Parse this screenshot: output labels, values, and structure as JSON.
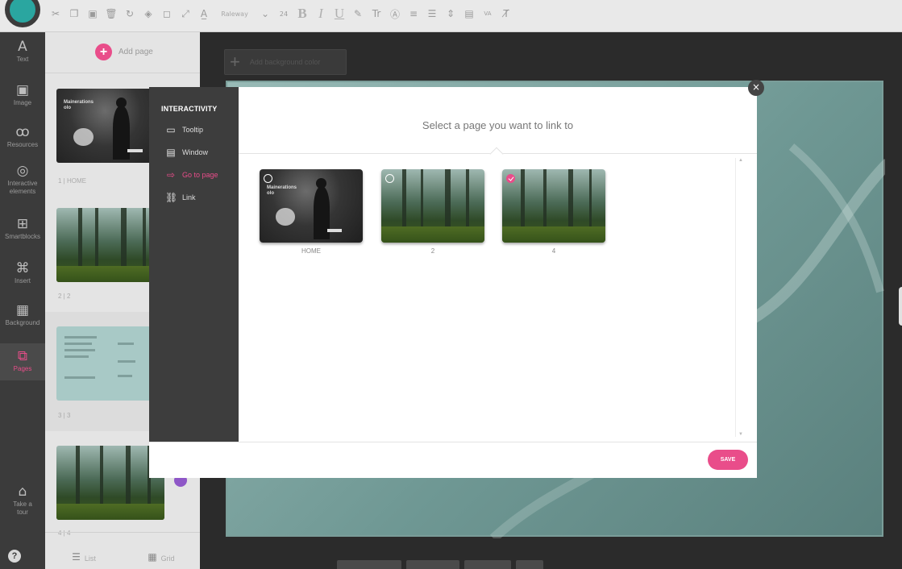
{
  "toolbar": {
    "font_name": "Raleway",
    "font_size": "24",
    "bold": "B",
    "italic": "I",
    "underline": "U",
    "text_size_label": "Tr",
    "va_label": "VA"
  },
  "rail": {
    "items": [
      {
        "label": "Text",
        "icon": "A"
      },
      {
        "label": "Image",
        "icon": "image-icon"
      },
      {
        "label": "Resources",
        "icon": "resources-icon"
      },
      {
        "label": "Interactive elements",
        "icon": "interactive-icon"
      },
      {
        "label": "Smartblocks",
        "icon": "smartblocks-icon"
      },
      {
        "label": "Insert",
        "icon": "insert-icon"
      },
      {
        "label": "Background",
        "icon": "background-icon"
      },
      {
        "label": "Pages",
        "icon": "pages-icon"
      },
      {
        "label": "Take a tour",
        "icon": "tour-icon"
      }
    ],
    "help": "?"
  },
  "pages_panel": {
    "add_page": "Add page",
    "thumb_title": "Mainerations\nolo",
    "labels": [
      "1 | HOME",
      "2 | 2",
      "3 | 3",
      "4 | 4"
    ],
    "bottom_tabs": {
      "list": "List",
      "grid": "Grid"
    }
  },
  "canvas": {
    "add_background": "Add background color"
  },
  "modal": {
    "side_heading": "INTERACTIVITY",
    "options": [
      {
        "label": "Tooltip",
        "icon": "tooltip-icon",
        "active": false
      },
      {
        "label": "Window",
        "icon": "window-icon",
        "active": false
      },
      {
        "label": "Go to page",
        "icon": "arrow-icon",
        "active": true
      },
      {
        "label": "Link",
        "icon": "link-icon",
        "active": false
      }
    ],
    "title": "Select a page you want to link to",
    "pages": [
      {
        "label": "HOME",
        "checked": false,
        "art": "dark"
      },
      {
        "label": "2",
        "checked": false,
        "art": "forest"
      },
      {
        "label": "4",
        "checked": true,
        "art": "forest"
      }
    ],
    "save": "SAVE",
    "close": "×"
  },
  "colors": {
    "accent": "#e94d8a",
    "rail": "#3b3b3b",
    "canvas": "#2b2b2b",
    "slide": "#6f9894"
  }
}
